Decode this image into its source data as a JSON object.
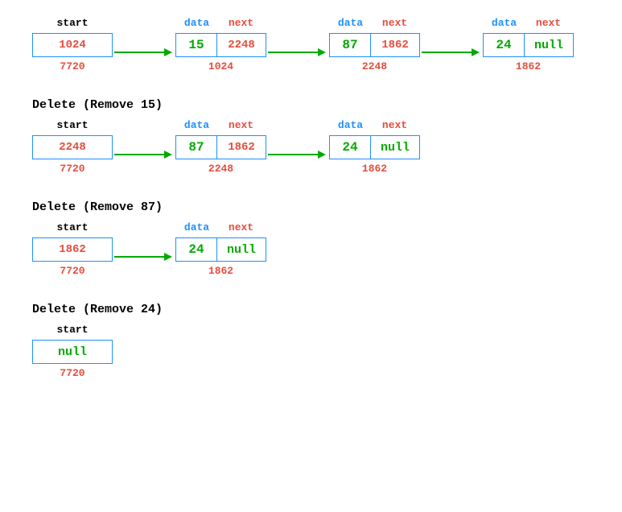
{
  "labels": {
    "start": "start",
    "data": "data",
    "next": "next"
  },
  "states": [
    {
      "title": null,
      "start": {
        "value": "1024",
        "addr": "7720",
        "isNull": false
      },
      "nodes": [
        {
          "data": "15",
          "next": "2248",
          "addr": "1024",
          "nextIsNull": false
        },
        {
          "data": "87",
          "next": "1862",
          "addr": "2248",
          "nextIsNull": false
        },
        {
          "data": "24",
          "next": "null",
          "addr": "1862",
          "nextIsNull": true
        }
      ]
    },
    {
      "title": "Delete  (Remove 15)",
      "start": {
        "value": "2248",
        "addr": "7720",
        "isNull": false
      },
      "nodes": [
        {
          "data": "87",
          "next": "1862",
          "addr": "2248",
          "nextIsNull": false
        },
        {
          "data": "24",
          "next": "null",
          "addr": "1862",
          "nextIsNull": true
        }
      ]
    },
    {
      "title": "Delete  (Remove 87)",
      "start": {
        "value": "1862",
        "addr": "7720",
        "isNull": false
      },
      "nodes": [
        {
          "data": "24",
          "next": "null",
          "addr": "1862",
          "nextIsNull": true
        }
      ]
    },
    {
      "title": "Delete  (Remove 24)",
      "start": {
        "value": "null",
        "addr": "7720",
        "isNull": true
      },
      "nodes": []
    }
  ]
}
